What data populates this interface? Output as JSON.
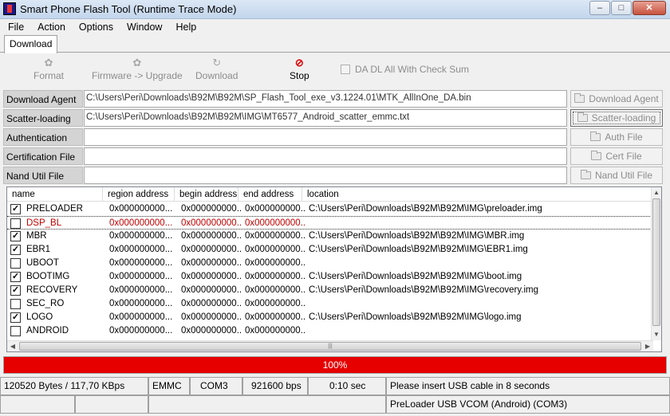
{
  "window": {
    "title": "Smart Phone Flash Tool (Runtime Trace Mode)",
    "min_glyph": "–",
    "max_glyph": "□",
    "close_glyph": "✕"
  },
  "menu": [
    "File",
    "Action",
    "Options",
    "Window",
    "Help"
  ],
  "tab": "Download",
  "toolbar": {
    "format": "Format",
    "firmware_upgrade": "Firmware -> Upgrade",
    "download": "Download",
    "stop": "Stop",
    "checksum": "DA DL All With Check Sum"
  },
  "files": {
    "download_agent": {
      "label": "Download Agent",
      "value": "C:\\Users\\Peri\\Downloads\\B92M\\B92M\\SP_Flash_Tool_exe_v3.1224.01\\MTK_AllInOne_DA.bin",
      "button": "Download Agent"
    },
    "scatter": {
      "label": "Scatter-loading File",
      "value": "C:\\Users\\Peri\\Downloads\\B92M\\B92M\\IMG\\MT6577_Android_scatter_emmc.txt",
      "button": "Scatter-loading"
    },
    "auth": {
      "label": "Authentication File",
      "value": "",
      "button": "Auth File"
    },
    "cert": {
      "label": "Certification File",
      "value": "",
      "button": "Cert File"
    },
    "nand": {
      "label": "Nand Util File",
      "value": "",
      "button": "Nand Util File"
    }
  },
  "list": {
    "columns": [
      "name",
      "region address",
      "begin address",
      "end address",
      "location"
    ],
    "rows": [
      {
        "checked": true,
        "name": "PRELOADER",
        "region": "0x000000000...",
        "begin": "0x000000000...",
        "end": "0x000000000...",
        "location": "C:\\Users\\Peri\\Downloads\\B92M\\B92M\\IMG\\preloader.img",
        "red": false
      },
      {
        "checked": false,
        "name": "DSP_BL",
        "region": "0x000000000...",
        "begin": "0x000000000...",
        "end": "0x000000000...",
        "location": "",
        "red": true
      },
      {
        "checked": true,
        "name": "MBR",
        "region": "0x000000000...",
        "begin": "0x000000000...",
        "end": "0x000000000...",
        "location": "C:\\Users\\Peri\\Downloads\\B92M\\B92M\\IMG\\MBR.img",
        "red": false
      },
      {
        "checked": true,
        "name": "EBR1",
        "region": "0x000000000...",
        "begin": "0x000000000...",
        "end": "0x000000000...",
        "location": "C:\\Users\\Peri\\Downloads\\B92M\\B92M\\IMG\\EBR1.img",
        "red": false
      },
      {
        "checked": false,
        "name": "UBOOT",
        "region": "0x000000000...",
        "begin": "0x000000000...",
        "end": "0x000000000...",
        "location": "",
        "red": false
      },
      {
        "checked": true,
        "name": "BOOTIMG",
        "region": "0x000000000...",
        "begin": "0x000000000...",
        "end": "0x000000000...",
        "location": "C:\\Users\\Peri\\Downloads\\B92M\\B92M\\IMG\\boot.img",
        "red": false
      },
      {
        "checked": true,
        "name": "RECOVERY",
        "region": "0x000000000...",
        "begin": "0x000000000...",
        "end": "0x000000000...",
        "location": "C:\\Users\\Peri\\Downloads\\B92M\\B92M\\IMG\\recovery.img",
        "red": false
      },
      {
        "checked": false,
        "name": "SEC_RO",
        "region": "0x000000000...",
        "begin": "0x000000000...",
        "end": "0x000000000...",
        "location": "",
        "red": false
      },
      {
        "checked": true,
        "name": "LOGO",
        "region": "0x000000000...",
        "begin": "0x000000000...",
        "end": "0x000000000...",
        "location": "C:\\Users\\Peri\\Downloads\\B92M\\B92M\\IMG\\logo.img",
        "red": false
      },
      {
        "checked": false,
        "name": "ANDROID",
        "region": "0x000000000...",
        "begin": "0x000000000...",
        "end": "0x000000000...",
        "location": "",
        "red": false
      }
    ]
  },
  "progress": {
    "percent_label": "100%",
    "fraction": 1.0,
    "color": "#e60000"
  },
  "status": {
    "transfer": "120520 Bytes / 117,70 KBps",
    "storage": "EMMC",
    "port": "COM3",
    "baud": "921600 bps",
    "time": "0:10 sec",
    "message": "Please insert USB cable in 8 seconds",
    "device": "PreLoader USB VCOM (Android) (COM3)"
  },
  "icons": {
    "stop": "stop-icon",
    "format": "format-icon",
    "firmware": "firmware-icon",
    "download": "download-icon",
    "folder": "folder-icon"
  }
}
